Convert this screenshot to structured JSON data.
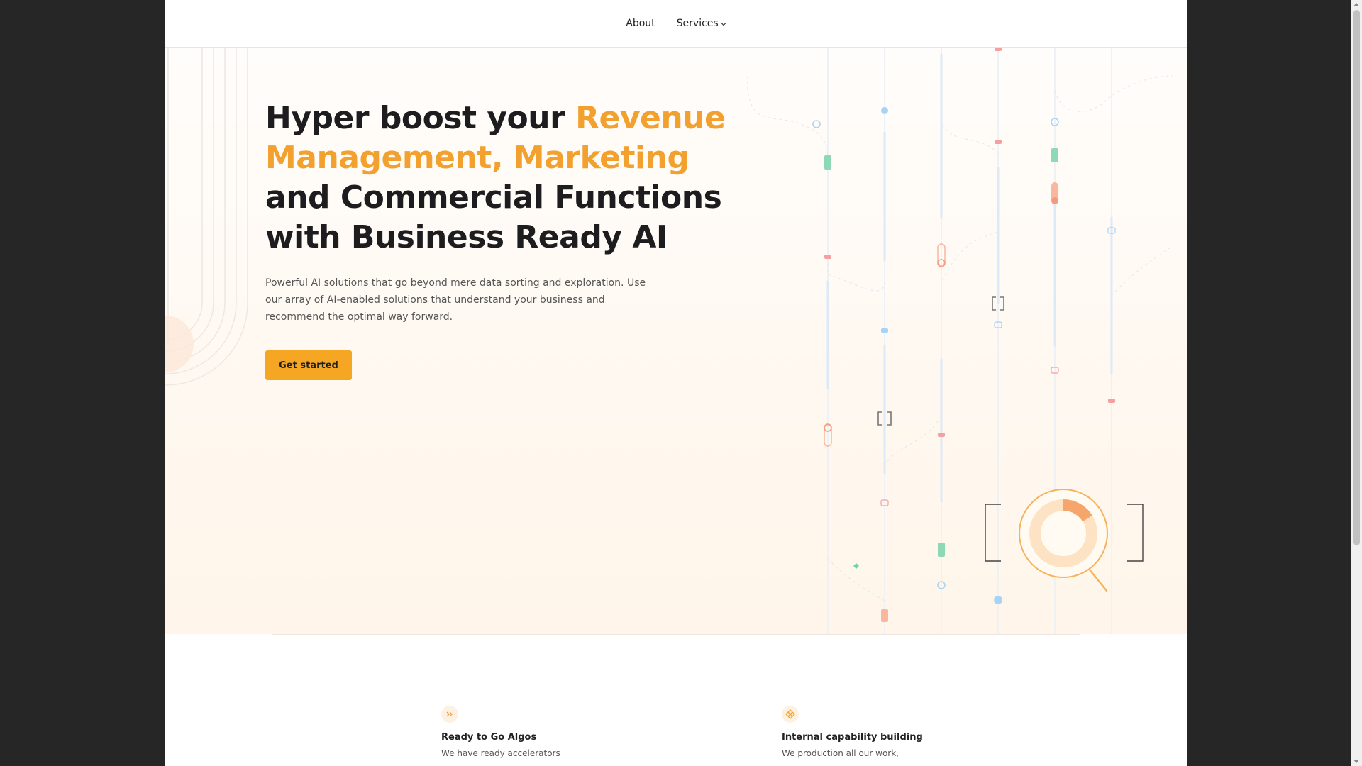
{
  "nav": {
    "about_label": "About",
    "services_label": "Services"
  },
  "hero": {
    "title_part1": "Hyper boost your ",
    "title_accent": "Revenue Management, Marketing",
    "title_part2": " and Commercial Functions with Business Ready AI",
    "description": "Powerful AI solutions that go beyond mere data sorting and exploration. Use our array of AI-enabled solutions that understand your business and recommend the optimal way forward.",
    "cta_label": "Get started"
  },
  "features": [
    {
      "icon": "double-chevron-right-icon",
      "title": "Ready to Go Algos",
      "description": "We have ready accelerators"
    },
    {
      "icon": "diamond-grid-icon",
      "title": "Internal capability building",
      "description": "We production all our work,"
    }
  ],
  "colors": {
    "accent": "#f3a12e",
    "button": "#f5a623",
    "background": "#262626"
  }
}
